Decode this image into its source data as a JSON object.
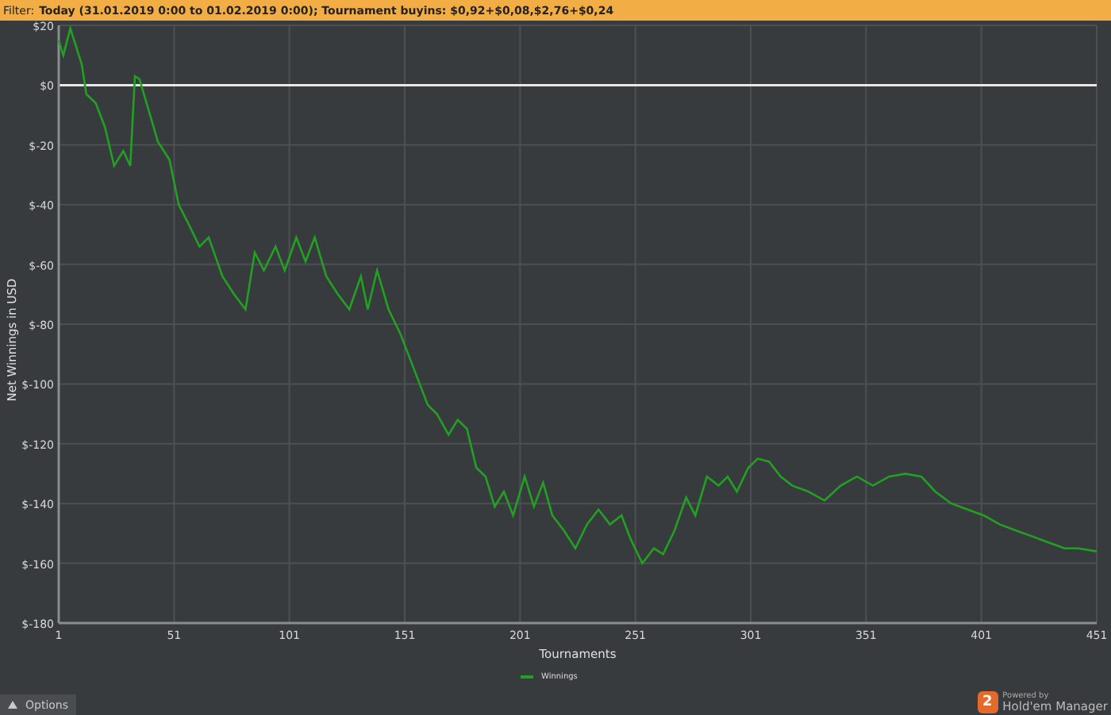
{
  "filter_bar": {
    "label": "Filter:",
    "text": "Today (31.01.2019 0:00 to 01.02.2019 0:00); Tournament buyins: $0,92+$0,08,$2,76+$0,24"
  },
  "chart": {
    "chart_data": {
      "type": "line",
      "grid": true,
      "xlabel": "Tournaments",
      "ylabel": "Net Winnings in USD",
      "xlim": [
        1,
        451
      ],
      "ylim": [
        -180,
        20
      ],
      "xticks": [
        1,
        51,
        101,
        151,
        201,
        251,
        301,
        351,
        401,
        451
      ],
      "yticks": [
        {
          "value": 20,
          "label": "$20"
        },
        {
          "value": 0,
          "label": "$0"
        },
        {
          "value": -20,
          "label": "$-20"
        },
        {
          "value": -40,
          "label": "$-40"
        },
        {
          "value": -60,
          "label": "$-60"
        },
        {
          "value": -80,
          "label": "$-80"
        },
        {
          "value": -100,
          "label": "$-100"
        },
        {
          "value": -120,
          "label": "$-120"
        },
        {
          "value": -140,
          "label": "$-140"
        },
        {
          "value": -160,
          "label": "$-160"
        },
        {
          "value": -180,
          "label": "$-180"
        }
      ],
      "x": [
        1,
        3,
        6,
        11,
        13,
        17,
        21,
        25,
        29,
        32,
        34,
        36,
        41,
        44,
        49,
        53,
        57,
        62,
        66,
        72,
        77,
        82,
        86,
        90,
        95,
        99,
        104,
        108,
        112,
        117,
        122,
        127,
        132,
        135,
        139,
        144,
        149,
        153,
        157,
        161,
        165,
        170,
        174,
        178,
        182,
        186,
        190,
        194,
        198,
        203,
        207,
        211,
        215,
        220,
        225,
        230,
        235,
        240,
        245,
        249,
        254,
        259,
        263,
        268,
        273,
        277,
        282,
        287,
        291,
        295,
        300,
        304,
        309,
        314,
        319,
        326,
        333,
        340,
        347,
        354,
        361,
        368,
        375,
        381,
        388,
        395,
        402,
        409,
        416,
        423,
        430,
        437,
        443,
        451
      ],
      "series": [
        {
          "name": "Winnings",
          "color": "#22a022",
          "values": [
            15,
            10,
            19,
            7,
            -3,
            -6,
            -14,
            -27,
            -22,
            -27,
            3,
            2,
            -11,
            -19,
            -25,
            -40,
            -46,
            -54,
            -51,
            -64,
            -70,
            -75,
            -56,
            -62,
            -54,
            -62,
            -51,
            -59,
            -51,
            -64,
            -70,
            -75,
            -64,
            -75,
            -62,
            -75,
            -83,
            -91,
            -99,
            -107,
            -110,
            -117,
            -112,
            -115,
            -128,
            -131,
            -141,
            -136,
            -144,
            -131,
            -141,
            -133,
            -144,
            -149,
            -155,
            -147,
            -142,
            -147,
            -144,
            -152,
            -160,
            -155,
            -157,
            -149,
            -138,
            -144,
            -131,
            -134,
            -131,
            -136,
            -128,
            -125,
            -126,
            -131,
            -134,
            -136,
            -139,
            -134,
            -131,
            -134,
            -131,
            -130,
            -131,
            -136,
            -140,
            -142,
            -144,
            -147,
            -149,
            -151,
            -153,
            -155,
            -155,
            -156
          ]
        }
      ]
    }
  },
  "options_button": {
    "label": "Options"
  },
  "branding": {
    "powered_by": "Powered by",
    "product": "Hold'em Manager",
    "badge": "2"
  }
}
